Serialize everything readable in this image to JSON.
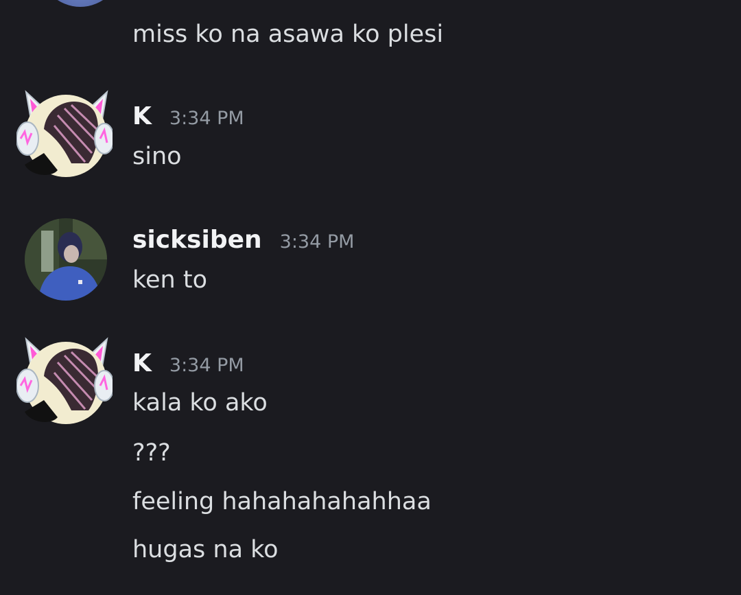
{
  "messages_top": {
    "continued_text": "miss ko na asawa ko plesi"
  },
  "groups": [
    {
      "username": "K",
      "timestamp": "3:34 PM",
      "avatar": "cat-ear-headphones-avatar",
      "lines": [
        "sino"
      ]
    },
    {
      "username": "sicksiben",
      "timestamp": "3:34 PM",
      "avatar": "photo-avatar",
      "lines": [
        "ken to"
      ]
    },
    {
      "username": "K",
      "timestamp": "3:34 PM",
      "avatar": "cat-ear-headphones-avatar",
      "lines": [
        "kala ko ako",
        "???",
        "feeling hahahahahahhaa",
        "hugas na ko"
      ]
    }
  ],
  "colors": {
    "background": "#1b1b20",
    "text": "#dbdee1",
    "username": "#f2f3f5",
    "timestamp": "#949ba4"
  }
}
